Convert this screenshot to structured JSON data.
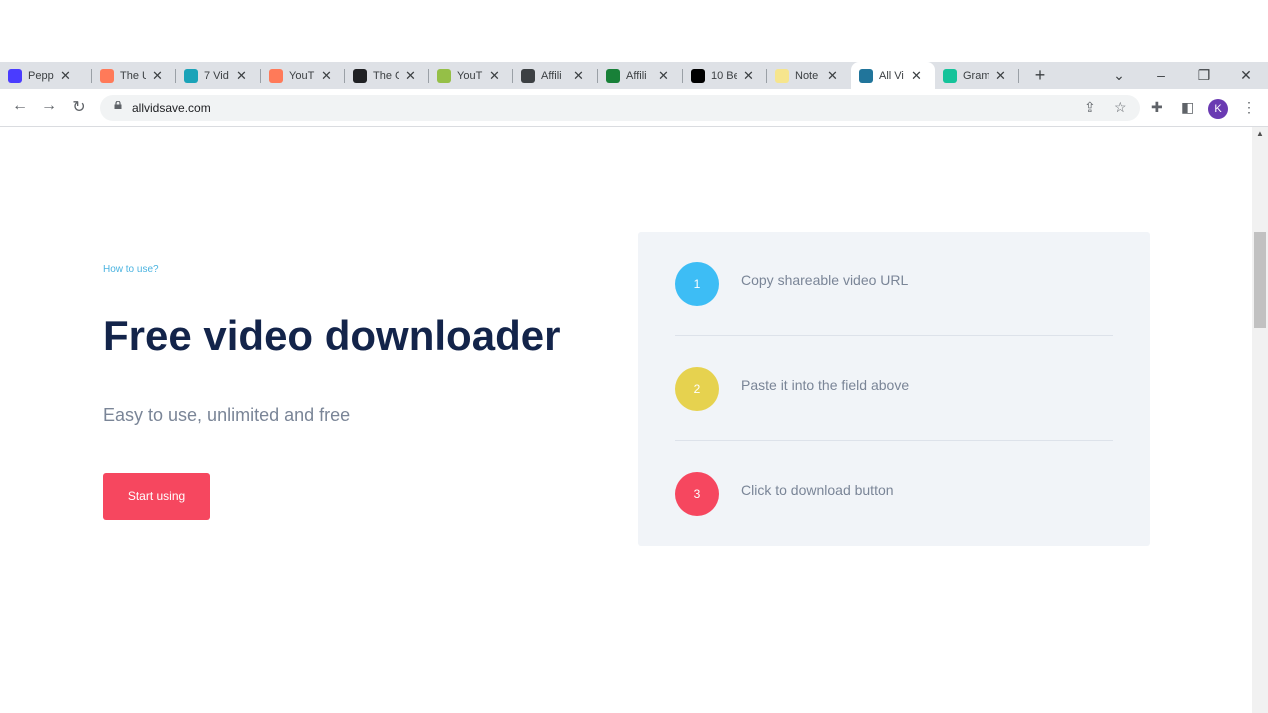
{
  "browser": {
    "tabs": [
      {
        "label": "Pepp",
        "icon": "peppertype-icon",
        "color": "#4a3cff"
      },
      {
        "label": "The U",
        "icon": "hubspot-icon",
        "color": "#ff7a59"
      },
      {
        "label": "7 Vid",
        "icon": "circle-icon",
        "color": "#1aa3b8"
      },
      {
        "label": "YouT",
        "icon": "hubspot-icon",
        "color": "#ff7a59"
      },
      {
        "label": "The C",
        "icon": "bookmark-icon",
        "color": "#202124"
      },
      {
        "label": "YouT",
        "icon": "shopify-icon",
        "color": "#95bf47"
      },
      {
        "label": "Affili",
        "icon": "chart-icon",
        "color": "#3c4043"
      },
      {
        "label": "Affili",
        "icon": "sheet-icon",
        "color": "#188038"
      },
      {
        "label": "10 Be",
        "icon": "medium-icon",
        "color": "#000000"
      },
      {
        "label": "Note",
        "icon": "note-icon",
        "color": "#f6e58d"
      },
      {
        "label": "All Vi",
        "icon": "wordpress-icon",
        "color": "#21759b"
      },
      {
        "label": "Gram",
        "icon": "grammarly-icon",
        "color": "#15c39a"
      }
    ],
    "active_tab_index": 10,
    "url": "allvidsave.com",
    "profile_initial": "K"
  },
  "page": {
    "eyebrow": "How to use?",
    "headline": "Free video downloader",
    "subheadline": "Easy to use, unlimited and free",
    "cta_label": "Start using",
    "steps": [
      {
        "number": "1",
        "text": "Copy shareable video URL",
        "color": "#3dbdf5"
      },
      {
        "number": "2",
        "text": "Paste it into the field above",
        "color": "#e6d24f"
      },
      {
        "number": "3",
        "text": "Click to download button",
        "color": "#f6475f"
      }
    ]
  }
}
